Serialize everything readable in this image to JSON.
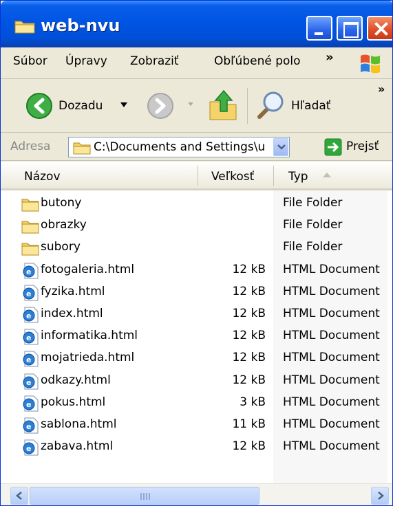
{
  "window": {
    "title": "web-nvu"
  },
  "menu": {
    "items": [
      "Súbor",
      "Úpravy",
      "Zobraziť",
      "Obľúbené polo"
    ],
    "more": "»"
  },
  "toolbar": {
    "back_label": "Dozadu",
    "search_label": "Hľadať",
    "more": "»"
  },
  "address": {
    "label": "Adresa",
    "value": "C:\\Documents and Settings\\u",
    "go_label": "Prejsť"
  },
  "list": {
    "columns": {
      "name": "Názov",
      "size": "Veľkosť",
      "type": "Typ"
    },
    "rows": [
      {
        "name": "butony",
        "size": "",
        "type": "File Folder",
        "icon": "folder-icon"
      },
      {
        "name": "obrazky",
        "size": "",
        "type": "File Folder",
        "icon": "folder-icon"
      },
      {
        "name": "subory",
        "size": "",
        "type": "File Folder",
        "icon": "folder-icon"
      },
      {
        "name": "fotogaleria.html",
        "size": "12 kB",
        "type": "HTML Document",
        "icon": "html-file-icon"
      },
      {
        "name": "fyzika.html",
        "size": "12 kB",
        "type": "HTML Document",
        "icon": "html-file-icon"
      },
      {
        "name": "index.html",
        "size": "12 kB",
        "type": "HTML Document",
        "icon": "html-file-icon"
      },
      {
        "name": "informatika.html",
        "size": "12 kB",
        "type": "HTML Document",
        "icon": "html-file-icon"
      },
      {
        "name": "mojatrieda.html",
        "size": "12 kB",
        "type": "HTML Document",
        "icon": "html-file-icon"
      },
      {
        "name": "odkazy.html",
        "size": "12 kB",
        "type": "HTML Document",
        "icon": "html-file-icon"
      },
      {
        "name": "pokus.html",
        "size": "3 kB",
        "type": "HTML Document",
        "icon": "html-file-icon"
      },
      {
        "name": "sablona.html",
        "size": "11 kB",
        "type": "HTML Document",
        "icon": "html-file-icon"
      },
      {
        "name": "zabava.html",
        "size": "12 kB",
        "type": "HTML Document",
        "icon": "html-file-icon"
      }
    ]
  },
  "colors": {
    "titlebar": "#0054e3",
    "chrome": "#ece9d8",
    "folder": "#f6d36b",
    "go_arrow": "#2fa83a"
  }
}
